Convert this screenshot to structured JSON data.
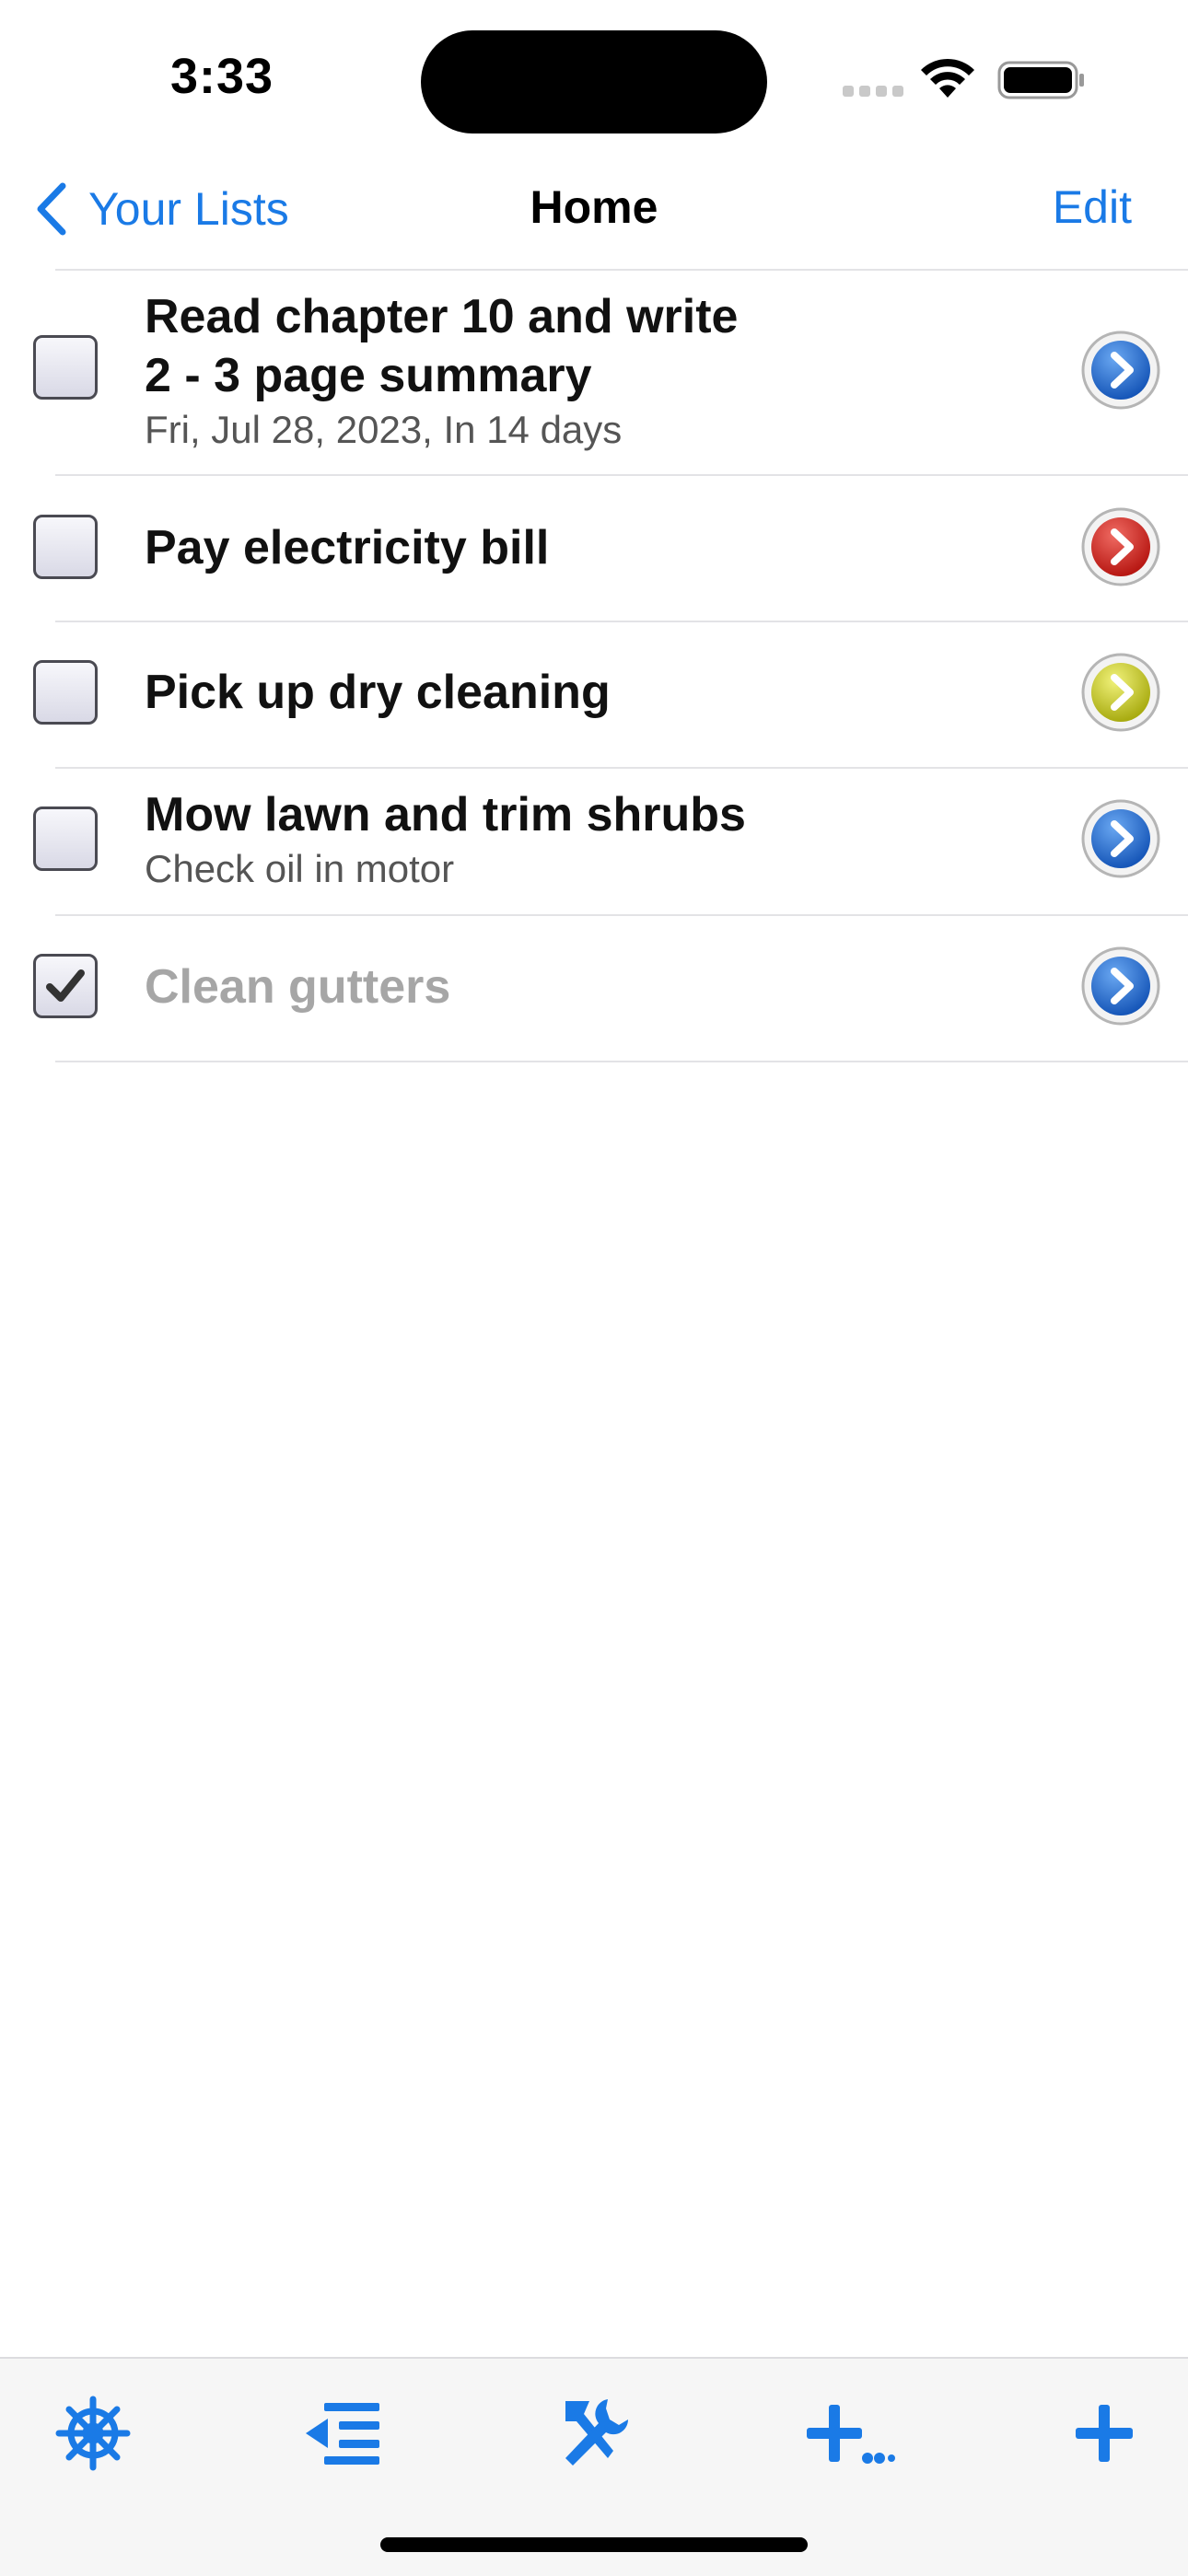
{
  "status_bar": {
    "time": "3:33"
  },
  "nav": {
    "back_label": "Your Lists",
    "title": "Home",
    "edit_label": "Edit"
  },
  "items": [
    {
      "title": "Read chapter 10 and write 2 - 3 page summary",
      "title_lines": [
        "Read chapter 10 and write",
        "2 - 3 page summary"
      ],
      "subtitle": "Fri, Jul 28, 2023, In 14 days",
      "checked": false,
      "arrow_color": "blue"
    },
    {
      "title": "Pay electricity bill",
      "subtitle": "",
      "checked": false,
      "arrow_color": "red"
    },
    {
      "title": "Pick up dry cleaning",
      "subtitle": "",
      "checked": false,
      "arrow_color": "yellow"
    },
    {
      "title": "Mow lawn and trim shrubs",
      "subtitle": "Check oil in motor",
      "checked": false,
      "arrow_color": "blue"
    },
    {
      "title": "Clean gutters",
      "subtitle": "",
      "checked": true,
      "arrow_color": "blue"
    }
  ],
  "colors": {
    "accent": "#1a7ae6",
    "arrow_blue": "#1f6fd6",
    "arrow_red": "#d9251e",
    "arrow_yellow": "#c9cc1d",
    "done_text": "#a6a6a6"
  },
  "toolbar": {
    "icons": [
      "ship-wheel-icon",
      "outdent-list-icon",
      "tools-icon",
      "add-multiple-icon",
      "add-icon"
    ]
  }
}
